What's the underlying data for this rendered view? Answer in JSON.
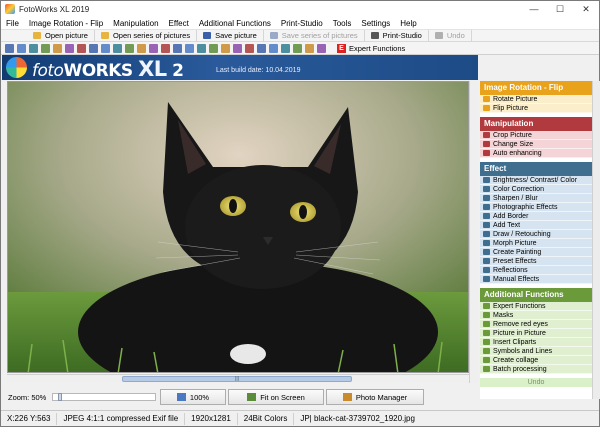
{
  "window": {
    "title": "FotoWorks XL 2019",
    "controls": [
      "—",
      "☐",
      "✕"
    ]
  },
  "menu": [
    "File",
    "Image Rotation - Flip",
    "Manipulation",
    "Effect",
    "Additional Functions",
    "Print-Studio",
    "Tools",
    "Settings",
    "Help"
  ],
  "toolbar": [
    {
      "label": "Open picture",
      "enabled": true,
      "icon": "folder-icon",
      "color": "#e8b440"
    },
    {
      "label": "Open series of pictures",
      "enabled": true,
      "icon": "folder-series-icon",
      "color": "#e8b440"
    },
    {
      "label": "Save picture",
      "enabled": true,
      "icon": "save-icon",
      "color": "#3a5fa8"
    },
    {
      "label": "Save series of pictures",
      "enabled": false,
      "icon": "save-series-icon",
      "color": "#9aa9c8"
    },
    {
      "label": "Print-Studio",
      "enabled": true,
      "icon": "printer-icon",
      "color": "#555"
    },
    {
      "label": "Undo",
      "enabled": false,
      "icon": "undo-icon",
      "color": "#b0b0b0"
    }
  ],
  "toolbar2": {
    "icons": [
      "save-icon",
      "rotate-left-icon",
      "rotate-right-icon",
      "rotate-icon",
      "rotate-icon",
      "flip-icon",
      "flip-icon",
      "crop-icon",
      "resize-icon",
      "wand-icon",
      "pencil-icon",
      "brush-icon",
      "grid-icon",
      "border-icon",
      "text-icon",
      "text-icon",
      "mask-icon",
      "draw-icon",
      "morph-icon",
      "image-icon",
      "collage-icon",
      "layers-icon",
      "eye-icon",
      "image-icon",
      "gear-icon",
      "tools-icon",
      "help-icon"
    ],
    "expert_label": "Expert Functions",
    "expert_badge": "E"
  },
  "banner": {
    "logo_foto": "foto",
    "logo_works": "WORKS",
    "logo_xl": "XL",
    "logo_num": "2",
    "build_label": "Last build date: 10.04.2019"
  },
  "zoom": {
    "label": "Zoom: 50%",
    "level": 0.05
  },
  "view_buttons": [
    {
      "label": "100%",
      "icon": "zoom-100-icon"
    },
    {
      "label": "Fit on Screen",
      "icon": "fit-screen-icon"
    },
    {
      "label": "Photo Manager",
      "icon": "photo-manager-icon"
    }
  ],
  "status": {
    "coords": "X:226 Y:563",
    "format": "JPEG 4:1:1 compressed Exif file",
    "dimensions": "1920x1281",
    "colors": "24Bit Colors",
    "file": "JP| black-cat-3739702_1920.jpg"
  },
  "sidebar": {
    "sections": [
      {
        "title": "Image Rotation - Flip",
        "head_color": "#e8a21c",
        "item_color": "#fbeeca",
        "items": [
          "Rotate Picture",
          "Flip Picture"
        ]
      },
      {
        "title": "Manipulation",
        "head_color": "#b03a3e",
        "item_color": "#f4d4d6",
        "items": [
          "Crop Picture",
          "Change Size",
          "Auto enhancing"
        ]
      },
      {
        "title": "Effect",
        "head_color": "#3f6e8f",
        "item_color": "#d6e4f1",
        "items": [
          "Brightness/ Contrast/ Color",
          "Color Correction",
          "Sharpen / Blur",
          "Photographic Effects",
          "Add Border",
          "Add Text",
          "Draw / Retouching",
          "Morph Picture",
          "Create Painting",
          "Preset Effects",
          "Reflections",
          "Manual Effects"
        ]
      },
      {
        "title": "Additional Functions",
        "head_color": "#6a9a3a",
        "item_color": "#e0efcf",
        "items": [
          "Expert Functions",
          "Masks",
          "Remove red eyes",
          "Picture in Picture",
          "Insert Cliparts",
          "Symbols and Lines",
          "Create collage",
          "Batch processing"
        ]
      }
    ],
    "undo_label": "Undo"
  }
}
